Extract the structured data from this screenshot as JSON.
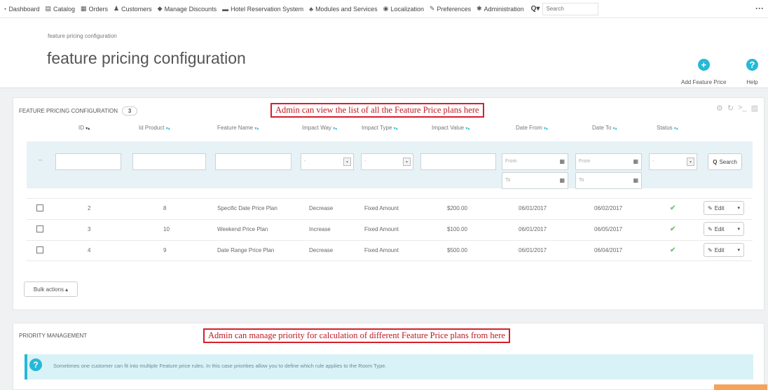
{
  "nav": {
    "items": [
      {
        "icon": "dashboard-icon",
        "glyph": "◔",
        "label": "Dashboard"
      },
      {
        "icon": "catalog-icon",
        "glyph": "▤",
        "label": "Catalog"
      },
      {
        "icon": "orders-icon",
        "glyph": "▦",
        "label": "Orders"
      },
      {
        "icon": "customers-icon",
        "glyph": "♟",
        "label": "Customers"
      },
      {
        "icon": "discounts-icon",
        "glyph": "◆",
        "label": "Manage Discounts"
      },
      {
        "icon": "hotel-icon",
        "glyph": "▬",
        "label": "Hotel Reservation System"
      },
      {
        "icon": "modules-icon",
        "glyph": "♣",
        "label": "Modules and Services"
      },
      {
        "icon": "localization-icon",
        "glyph": "◉",
        "label": "Localization"
      },
      {
        "icon": "preferences-icon",
        "glyph": "✎",
        "label": "Preferences"
      },
      {
        "icon": "administration-icon",
        "glyph": "✱",
        "label": "Administration"
      }
    ],
    "search_dropdown": "Q▾",
    "search_placeholder": "Search",
    "more": "···"
  },
  "header": {
    "breadcrumb": "feature pricing configuration",
    "title": "feature pricing configuration",
    "add_label": "Add Feature Price",
    "help_label": "Help",
    "add_glyph": "+",
    "help_glyph": "?"
  },
  "list_panel": {
    "heading": "FEATURE PRICING CONFIGURATION",
    "count": "3",
    "callout": "Admin can view the list of all the Feature Price plans here",
    "tools": [
      "⚙",
      "↻",
      ">_",
      "▥"
    ],
    "columns": [
      "ID",
      "Id Product",
      "Feature Name",
      "Impact Way",
      "Impact Type",
      "Impact Value",
      "Date From",
      "Date To",
      "Status"
    ],
    "sort_glyph": "▾▴",
    "filter": {
      "dash": "--",
      "select_dash": "-",
      "select_arrow": "▾",
      "from_placeholder": "From",
      "to_placeholder": "To",
      "calendar_glyph": "▦",
      "search_label": "Search",
      "search_icon_glyph": "Q"
    },
    "rows": [
      {
        "id": "2",
        "product": "8",
        "name": "Specific Date Price Plan",
        "way": "Decrease",
        "type": "Fixed Amount",
        "value": "$200.00",
        "from": "06/01/2017",
        "to": "06/02/2017"
      },
      {
        "id": "3",
        "product": "10",
        "name": "Weekend Price Plan",
        "way": "Increase",
        "type": "Fixed Amount",
        "value": "$100.00",
        "from": "06/01/2017",
        "to": "06/05/2017"
      },
      {
        "id": "4",
        "product": "9",
        "name": "Date Range Price Plan",
        "way": "Decrease",
        "type": "Fixed Amount",
        "value": "$500.00",
        "from": "06/01/2017",
        "to": "06/04/2017"
      }
    ],
    "status_glyph": "✔",
    "edit_label": "Edit",
    "edit_glyph": "✎",
    "edit_caret": "▾",
    "bulk_label": "Bulk actions ▴"
  },
  "priority_panel": {
    "heading": "PRIORITY MANAGEMENT",
    "callout": "Admin can manage priority for calculation of different Feature Price plans from here",
    "info_glyph": "?",
    "info_text": "Sometimes one customer can fit into multiple Feature price rules. In this case priorities allow you to define which rule applies to the Room Type."
  }
}
